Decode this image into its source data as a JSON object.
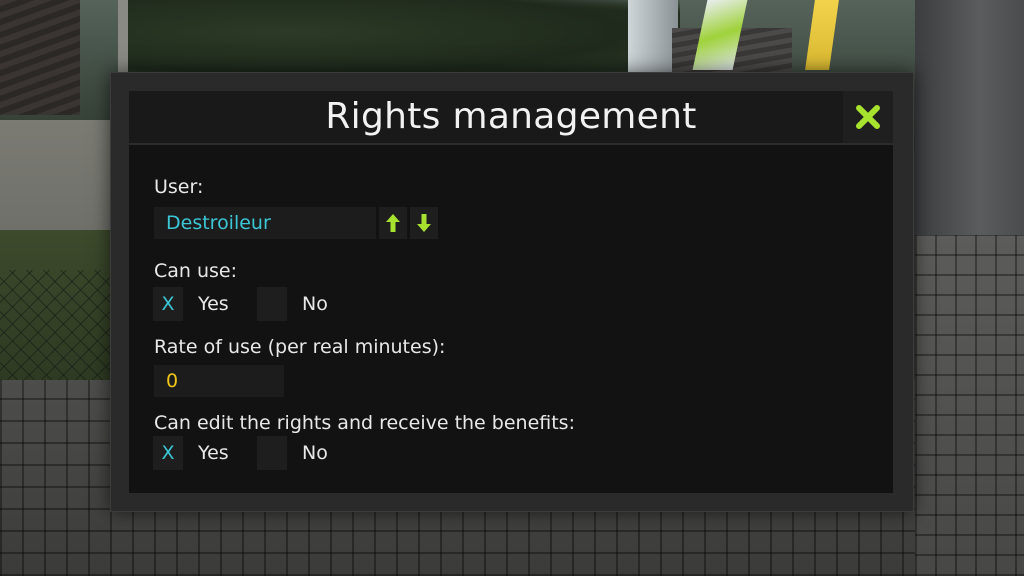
{
  "dialog": {
    "title": "Rights management"
  },
  "user": {
    "label": "User:",
    "value": "Destroileur"
  },
  "can_use": {
    "label": "Can use:",
    "yes_mark": "X",
    "yes_label": "Yes",
    "no_mark": "",
    "no_label": "No",
    "selected": "Yes"
  },
  "rate": {
    "label": "Rate of use (per real minutes):",
    "value": "0"
  },
  "can_edit": {
    "label": "Can edit the rights and receive the benefits:",
    "yes_mark": "X",
    "yes_label": "Yes",
    "no_mark": "",
    "no_label": "No",
    "selected": "Yes"
  },
  "icons": {
    "close": "close-x-icon",
    "previous": "arrow-up-icon",
    "next": "arrow-down-icon"
  },
  "colors": {
    "accent_green": "#a6e22e",
    "user_value": "#3cc6d6",
    "rate_value": "#f0c419",
    "check_mark": "#3cc6d6"
  }
}
